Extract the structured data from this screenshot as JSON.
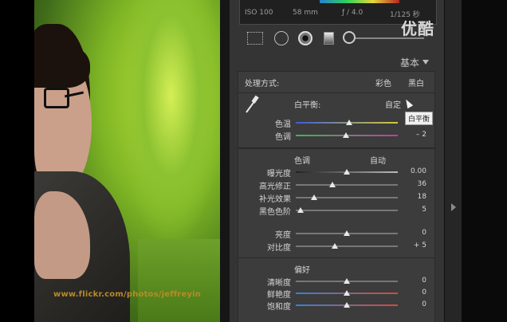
{
  "overlay": {
    "logo": "优酷"
  },
  "photo": {
    "watermark": "www.flickr.com/photos/jeffreyin"
  },
  "histogram": {
    "iso": "ISO 100",
    "focal": "58 mm",
    "aperture": "ƒ / 4.0",
    "shutter": "1/125 秒"
  },
  "panel": {
    "title": "基本",
    "treatment": {
      "label": "处理方式:",
      "color": "彩色",
      "bw": "黑白"
    },
    "white_balance": {
      "label": "白平衡:",
      "value": "自定",
      "tooltip": "白平衡",
      "sliders": [
        {
          "label": "色温",
          "value": "",
          "pos": 0.52,
          "colors": [
            "#3d5bd6",
            "#d6c83a"
          ]
        },
        {
          "label": "色调",
          "value": "– 2",
          "pos": 0.49,
          "colors": [
            "#3bb84a",
            "#c23aa8"
          ]
        }
      ]
    },
    "tone": {
      "title": "色调",
      "auto": "自动",
      "sliders": [
        {
          "label": "曝光度",
          "value": "0.00",
          "pos": 0.5,
          "colors": [
            "#222222",
            "#bbbbbb"
          ]
        },
        {
          "label": "高光修正",
          "value": "36",
          "pos": 0.36,
          "colors": [
            "#777777",
            "#777777"
          ]
        },
        {
          "label": "补光效果",
          "value": "18",
          "pos": 0.18,
          "colors": [
            "#777777",
            "#777777"
          ]
        },
        {
          "label": "黑色色阶",
          "value": "5",
          "pos": 0.05,
          "colors": [
            "#777777",
            "#777777"
          ]
        },
        {
          "label": "亮度",
          "value": "0",
          "pos": 0.5,
          "colors": [
            "#777777",
            "#777777"
          ]
        },
        {
          "label": "对比度",
          "value": "+ 5",
          "pos": 0.38,
          "colors": [
            "#777777",
            "#777777"
          ]
        }
      ]
    },
    "presence": {
      "title": "偏好",
      "sliders": [
        {
          "label": "清晰度",
          "value": "0",
          "pos": 0.5,
          "colors": [
            "#777777",
            "#777777"
          ]
        },
        {
          "label": "鲜艳度",
          "value": "0",
          "pos": 0.5,
          "colors": [
            "#3a7fd6",
            "#d64a3a"
          ]
        },
        {
          "label": "饱和度",
          "value": "0",
          "pos": 0.5,
          "colors": [
            "#3a7fd6",
            "#d64a3a"
          ]
        }
      ]
    }
  }
}
